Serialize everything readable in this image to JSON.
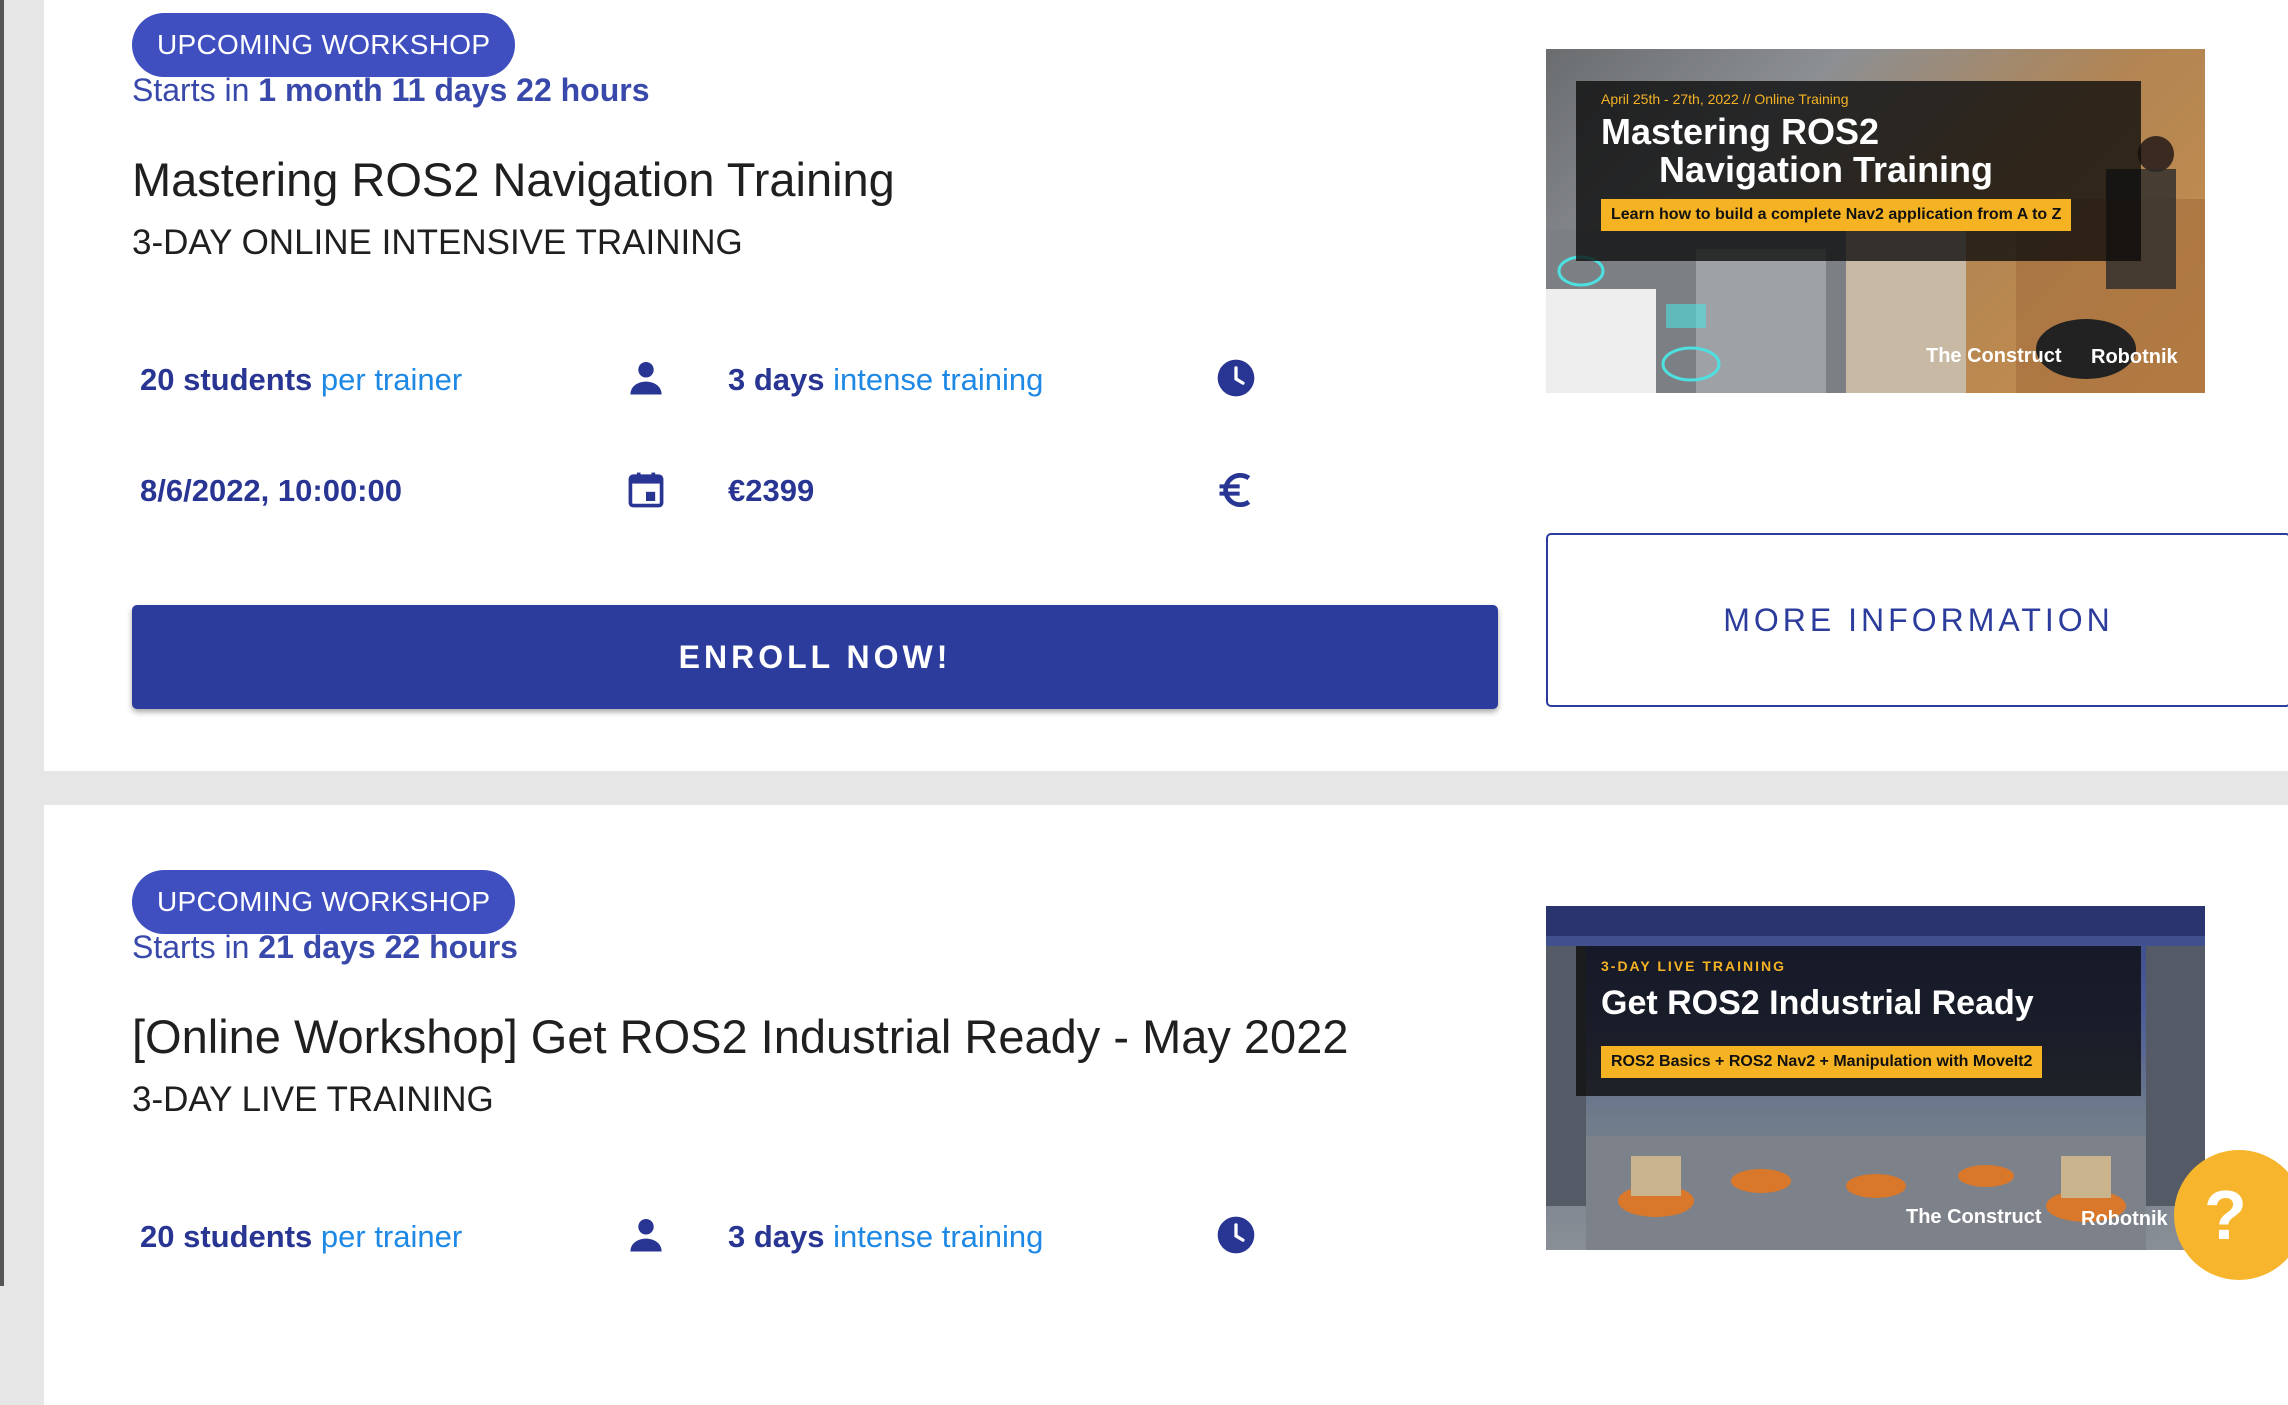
{
  "workshops": [
    {
      "badge": "UPCOMING WORKSHOP",
      "starts_prefix": "Starts in",
      "starts_value": "1 month 11 days 22 hours",
      "title": "Mastering ROS2 Navigation Training",
      "subtitle": "3-DAY ONLINE INTENSIVE TRAINING",
      "students_strong": "20 students",
      "students_light": "per trainer",
      "days_strong": "3 days",
      "days_light": "intense training",
      "date": "8/6/2022, 10:00:00",
      "price": "€2399",
      "enroll_label": "ENROLL NOW!",
      "more_label": "MORE INFORMATION",
      "image": {
        "date_line": "April 25th - 27th, 2022  //  Online Training",
        "title_line1": "Mastering ROS2",
        "title_line2": "Navigation Training",
        "highlight": "Learn how to build a complete Nav2 application from A to Z",
        "logo_construct": "The Construct",
        "logo_robotnik": "Robotnik"
      }
    },
    {
      "badge": "UPCOMING WORKSHOP",
      "starts_prefix": "Starts in",
      "starts_value": "21 days 22 hours",
      "title": "[Online Workshop] Get ROS2 Industrial Ready - May 2022",
      "subtitle": "3-DAY LIVE TRAINING",
      "students_strong": "20 students",
      "students_light": "per trainer",
      "days_strong": "3 days",
      "days_light": "intense training",
      "image": {
        "kicker": "3-DAY LIVE TRAINING",
        "title_line1": "Get ROS2 Industrial Ready",
        "highlight": "ROS2 Basics + ROS2 Nav2 + Manipulation with MoveIt2",
        "logo_construct": "The Construct",
        "logo_robotnik": "Robotnik"
      }
    }
  ],
  "help_button": "?",
  "colors": {
    "primary": "#2b3c9c",
    "badge": "#3f4fc0",
    "accent_blue": "#1e88e5",
    "help": "#f7b52e"
  }
}
